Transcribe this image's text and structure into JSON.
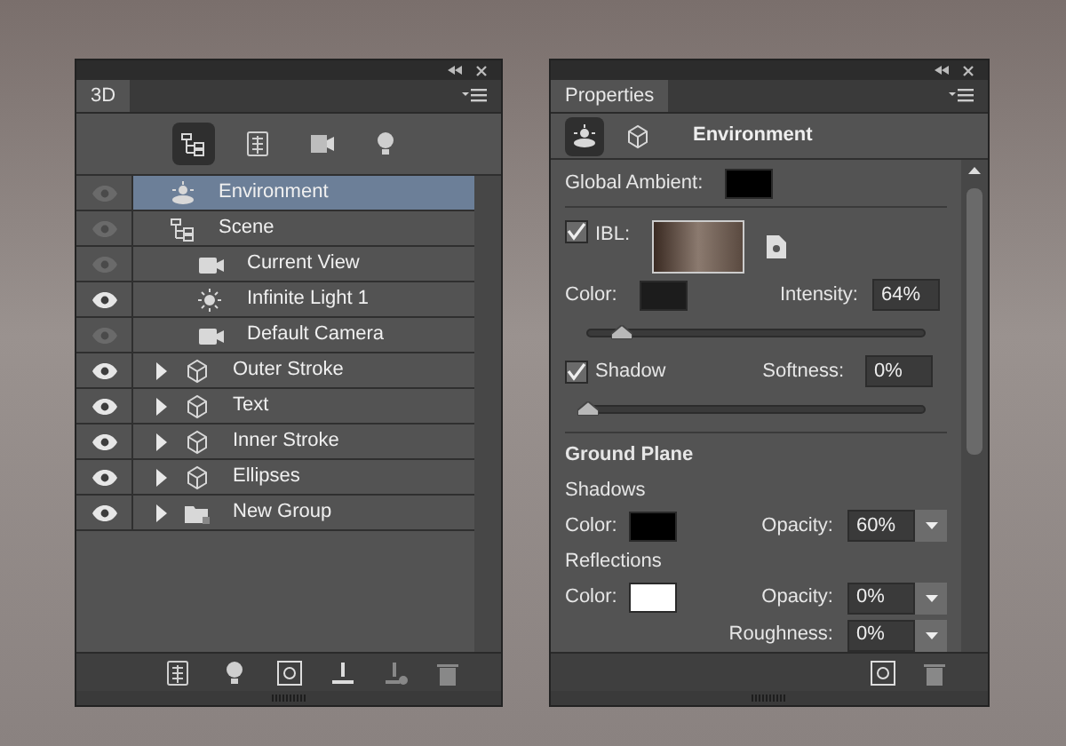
{
  "layers_panel": {
    "tab": "3D",
    "filters": [
      {
        "kind": "scene",
        "selected": true
      },
      {
        "kind": "mesh",
        "selected": false
      },
      {
        "kind": "material",
        "selected": false
      },
      {
        "kind": "light",
        "selected": false
      }
    ],
    "layers": [
      {
        "name": "Environment",
        "kind": "environment",
        "visible": false,
        "selected": true
      },
      {
        "name": "Scene",
        "kind": "scene",
        "visible": false,
        "selected": false,
        "children": [
          {
            "name": "Current View",
            "kind": "camera",
            "visible": false,
            "selected": false
          },
          {
            "name": "Infinite Light 1",
            "kind": "light",
            "visible": true,
            "selected": false
          },
          {
            "name": "Default Camera",
            "kind": "camera",
            "visible": false,
            "selected": false
          }
        ]
      },
      {
        "name": "Outer Stroke",
        "kind": "mesh",
        "visible": true,
        "selected": false,
        "expanded": false
      },
      {
        "name": "Text",
        "kind": "mesh",
        "visible": true,
        "selected": false,
        "expanded": false
      },
      {
        "name": "Inner Stroke",
        "kind": "mesh",
        "visible": true,
        "selected": false,
        "expanded": false
      },
      {
        "name": "Ellipses",
        "kind": "mesh",
        "visible": true,
        "selected": false,
        "expanded": false
      },
      {
        "name": "New Group",
        "kind": "group",
        "visible": true,
        "selected": false,
        "expanded": false
      }
    ]
  },
  "properties_panel": {
    "tab": "Properties",
    "title": "Environment",
    "modes": [
      {
        "kind": "environment",
        "selected": true
      },
      {
        "kind": "mesh",
        "selected": false
      }
    ],
    "global_ambient": {
      "label": "Global Ambient:",
      "color": "#000000"
    },
    "ibl": {
      "label": "IBL:",
      "checked": true,
      "color_label": "Color:",
      "color": "#1c1c1c",
      "intensity_label": "Intensity:",
      "intensity": "64%",
      "level": 0.1
    },
    "shadow": {
      "label": "Shadow",
      "checked": true,
      "softness_label": "Softness:",
      "softness": "0%",
      "level": 0
    },
    "ground_plane": {
      "heading": "Ground Plane",
      "shadows": {
        "heading": "Shadows",
        "color_label": "Color:",
        "color": "#000000",
        "opacity_label": "Opacity:",
        "opacity": "60%"
      },
      "reflections": {
        "heading": "Reflections",
        "color_label": "Color:",
        "color": "#ffffff",
        "opacity_label": "Opacity:",
        "opacity": "0%",
        "roughness_label": "Roughness:",
        "roughness": "0%"
      }
    }
  }
}
